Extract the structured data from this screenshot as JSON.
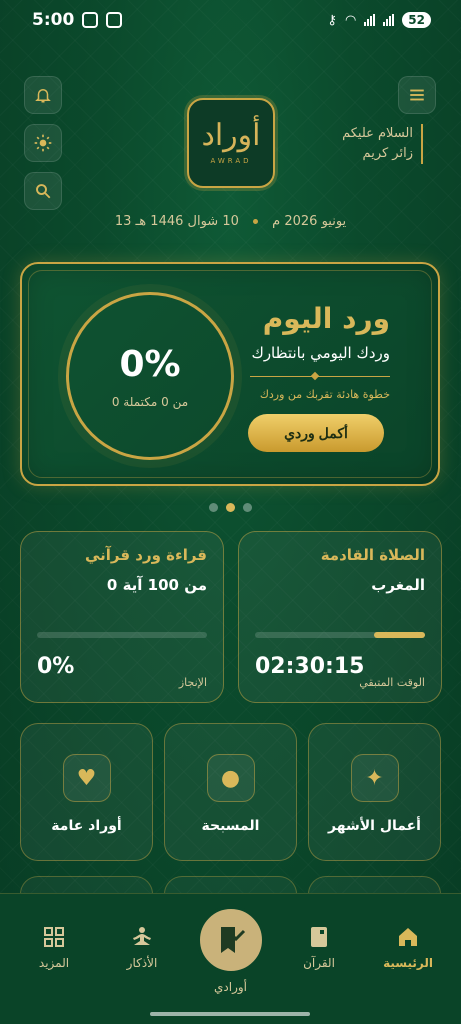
{
  "status_bar": {
    "time": "5:00",
    "battery": "52"
  },
  "header": {
    "greeting_line1": "السلام عليكم",
    "greeting_line2": "زائر كريم",
    "logo_text": "أوراد",
    "logo_sub": "AWRAD",
    "hijri_date": "10 شوال 1446 هـ",
    "gregorian_date": "13 يونيو 2026 م"
  },
  "hero": {
    "title": "ورد اليوم",
    "subtitle": "وردك اليومي بانتظارك",
    "note": "خطوة هادئة تقربك من وردك",
    "button": "أكمل وردي",
    "percent": "0%",
    "progress_text": "0 من 0 مكتملة"
  },
  "cards": {
    "prayer": {
      "title": "الصلاة القادمة",
      "name": "المغرب",
      "time": "02:30:15",
      "caption": "الوقت المتبقي",
      "progress": 0.3
    },
    "quran": {
      "title": "قراءة ورد قرآني",
      "value": "0 من 100 آية",
      "percent": "0%",
      "caption": "الإنجاز",
      "progress": 0
    }
  },
  "tiles": [
    {
      "label": "أعمال الأشهر",
      "icon": "sparkles-icon"
    },
    {
      "label": "المسبحة",
      "icon": "tasbih-icon"
    },
    {
      "label": "أوراد عامة",
      "icon": "hand-heart-icon"
    }
  ],
  "nav": {
    "home": "الرئيسية",
    "quran": "القرآن",
    "awradi": "أورادي",
    "adhkar": "الأذكار",
    "more": "المزيد"
  },
  "colors": {
    "accent": "#d9b85a",
    "background": "#0b4a2c"
  }
}
